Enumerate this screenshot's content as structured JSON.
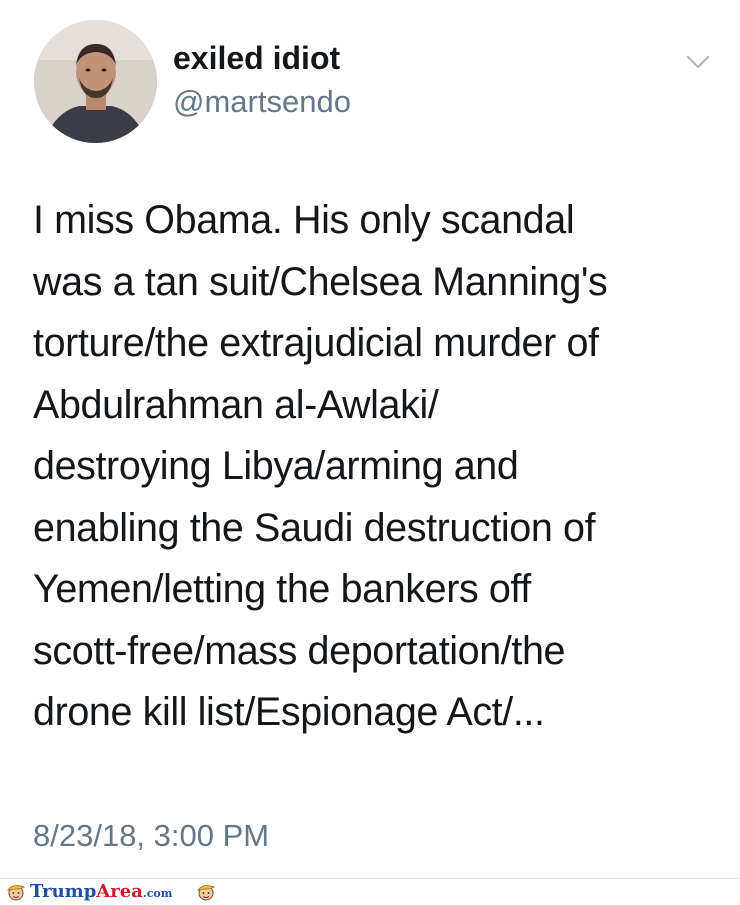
{
  "tweet": {
    "display_name": "exiled idiot",
    "handle": "@martsendo",
    "text_lines": [
      "I miss Obama. His only scandal",
      "was a tan suit/Chelsea Manning's",
      "torture/the extrajudicial murder of",
      "Abdulrahman al-Awlaki/",
      "destroying Libya/arming and",
      "enabling the Saudi destruction of",
      "Yemen/letting the bankers off",
      "scott-free/mass deportation/the",
      "drone kill list/Espionage Act/..."
    ],
    "timestamp": "8/23/18, 3:00 PM",
    "avatar_icon": "profile-photo",
    "menu_icon": "chevron-down-icon"
  },
  "watermark": {
    "brand_part1": "Trump",
    "brand_part2": "Area",
    "brand_part3": ".com",
    "colors": {
      "blue": "#1e4fa3",
      "red": "#c8202a"
    }
  },
  "colors": {
    "text": "#14171a",
    "secondary": "#657786",
    "background": "#ffffff"
  }
}
